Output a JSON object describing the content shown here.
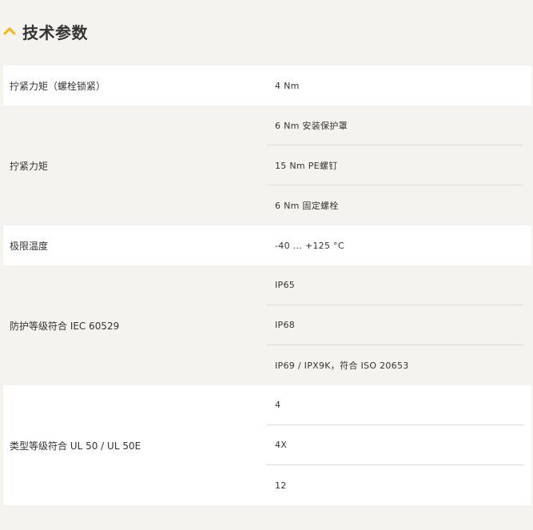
{
  "section": {
    "title": "技术参数",
    "accent_color": "#f5b400",
    "icon": "chevron-up-icon"
  },
  "specs": [
    {
      "label": "拧紧力矩（螺栓锁紧）",
      "values": [
        "4 Nm"
      ]
    },
    {
      "label": "拧紧力矩",
      "values": [
        "6 Nm 安装保护罩",
        "15 Nm PE螺钉",
        "6 Nm 固定螺栓"
      ]
    },
    {
      "label": "极限温度",
      "values": [
        "-40 ... +125 °C"
      ]
    },
    {
      "label": "防护等级符合 IEC 60529",
      "values": [
        "IP65",
        "IP68",
        "IP69 / IPX9K，符合 ISO 20653"
      ]
    },
    {
      "label": "类型等级符合 UL 50 / UL 50E",
      "values": [
        "4",
        "4X",
        "12"
      ]
    }
  ]
}
